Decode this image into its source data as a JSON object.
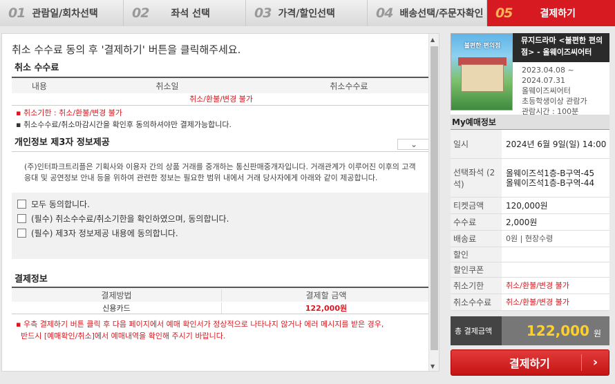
{
  "steps": [
    {
      "num": "01",
      "label": "관람일/회차선택"
    },
    {
      "num": "02",
      "label": "좌석 선택"
    },
    {
      "num": "03",
      "label": "가격/할인선택"
    },
    {
      "num": "04",
      "label": "배송선택/주문자확인"
    },
    {
      "num": "05",
      "label": "결제하기"
    }
  ],
  "notice": "취소 수수료 동의 후 '결제하기' 버튼을 클릭해주세요.",
  "cancel_fee": {
    "title": "취소 수수료",
    "headers": [
      "내용",
      "취소일",
      "취소수수료"
    ],
    "row": "취소/환불/변경 불가",
    "bullets": [
      "취소기한 : 취소/환불/변경 불가",
      "취소수수료/취소마감시간을 확인후 동의하셔야만 결제가능합니다."
    ]
  },
  "privacy": {
    "title": "개인정보 제3자 정보제공",
    "text": "(주)인터파크트리플은 기획사와 이용자 간의 상품 거래를 중개하는 통신판매중개자입니다. 거래관계가 이루어진 이후의 고객응대 및 공연정보 안내 등을 위하여 관련한 정보는 필요한 범위 내에서 거래 당사자에게 아래와 같이 제공합니다."
  },
  "agreements": [
    "모두 동의합니다.",
    "(필수) 취소수수료/취소기한을 확인하였으며, 동의합니다.",
    "(필수) 제3자 정보제공 내용에 동의합니다."
  ],
  "payment_info": {
    "title": "결제정보",
    "headers": [
      "결제방법",
      "결제할 금액"
    ],
    "method": "신용카드",
    "amount": "122,000원",
    "notes": [
      "우측 결제하기 버튼 클릭 후 다음 페이지에서 예매 확인서가 정상적으로 나타나지 않거나 에러 메시지를 받은 경우,",
      "반드시 [예매확인/취소]에서 예매내역을 확인해 주시기 바랍니다."
    ]
  },
  "performance": {
    "poster_text": "불편한 편의점",
    "name": "뮤지드라마 <불편한 편의점> - 올웨이즈씨어터",
    "period": "2023.04.08 ~ 2024.07.31",
    "venue": "올웨이즈씨어터",
    "age": "초등학생이상 관람가",
    "runtime": "관람시간 : 100분"
  },
  "my_booking": {
    "title": "My예매정보",
    "datetime": "2024년 6월 9일(일) 14:00",
    "seat_label": "선택좌석 (2석)",
    "seats": [
      "올웨이즈석1층-B구역-45",
      "올웨이즈석1층-B구역-44"
    ],
    "rows": [
      {
        "label": "일시"
      },
      {
        "label": "티켓금액",
        "value": "120,000원"
      },
      {
        "label": "수수료",
        "value": "2,000원"
      },
      {
        "label": "배송료",
        "value": "0원 | 현장수령"
      },
      {
        "label": "할인",
        "value": ""
      },
      {
        "label": "할인쿠폰",
        "value": ""
      },
      {
        "label": "취소기한",
        "value": "취소/환불/변경 불가"
      },
      {
        "label": "취소수수료",
        "value": "취소/환불/변경 불가"
      }
    ],
    "total_label": "총 결제금액",
    "total_amount": "122,000",
    "total_unit": "원",
    "pay_button": "결제하기",
    "pay_arrow": "›"
  },
  "colors": {
    "accent": "#d71a21",
    "total_amount": "#ffd02a"
  }
}
